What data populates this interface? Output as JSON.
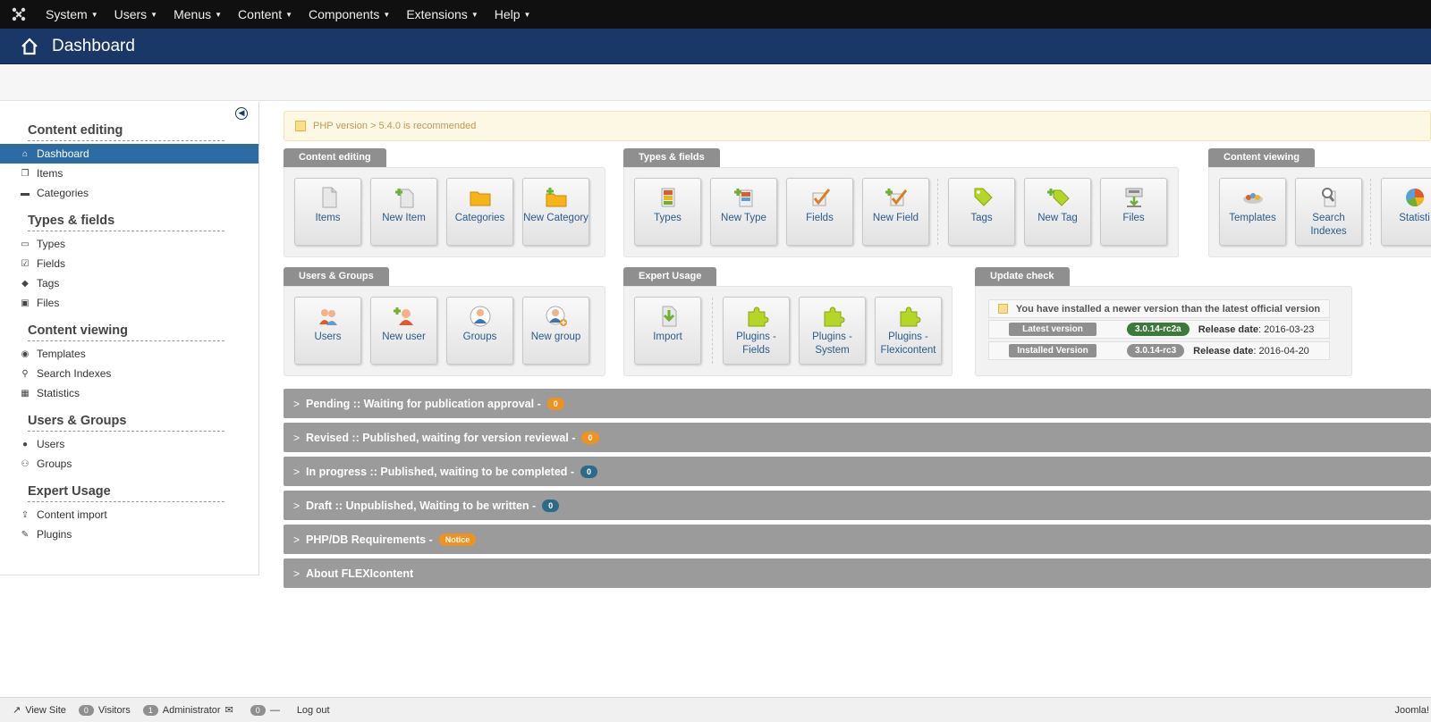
{
  "topnav": {
    "menu": [
      "System",
      "Users",
      "Menus",
      "Content",
      "Components",
      "Extensions",
      "Help"
    ]
  },
  "titlebar": {
    "title": "Dashboard"
  },
  "sidebar": {
    "sections": [
      {
        "title": "Content editing",
        "items": [
          {
            "label": "Dashboard",
            "icon": "home-icon",
            "active": true
          },
          {
            "label": "Items",
            "icon": "copy-icon"
          },
          {
            "label": "Categories",
            "icon": "folder-icon"
          }
        ]
      },
      {
        "title": "Types & fields",
        "items": [
          {
            "label": "Types",
            "icon": "briefcase-icon"
          },
          {
            "label": "Fields",
            "icon": "checkbox-icon"
          },
          {
            "label": "Tags",
            "icon": "tag-icon"
          },
          {
            "label": "Files",
            "icon": "image-icon"
          }
        ]
      },
      {
        "title": "Content viewing",
        "items": [
          {
            "label": "Templates",
            "icon": "eye-icon"
          },
          {
            "label": "Search Indexes",
            "icon": "search-icon"
          },
          {
            "label": "Statistics",
            "icon": "chart-icon"
          }
        ]
      },
      {
        "title": "Users & Groups",
        "items": [
          {
            "label": "Users",
            "icon": "user-icon"
          },
          {
            "label": "Groups",
            "icon": "users-icon"
          }
        ]
      },
      {
        "title": "Expert Usage",
        "items": [
          {
            "label": "Content import",
            "icon": "upload-icon"
          },
          {
            "label": "Plugins",
            "icon": "plug-icon"
          }
        ]
      }
    ]
  },
  "alert": {
    "text": "PHP version > 5.4.0 is recommended"
  },
  "panels": {
    "content_editing": {
      "label": "Content editing",
      "tiles": [
        "Items",
        "New Item",
        "Categories",
        "New Category"
      ]
    },
    "types_fields": {
      "label": "Types & fields",
      "tiles": [
        "Types",
        "New Type",
        "Fields",
        "New Field",
        "Tags",
        "New Tag",
        "Files"
      ]
    },
    "content_viewing": {
      "label": "Content viewing",
      "tiles": [
        "Templates",
        "Search Indexes",
        "Statisti"
      ]
    },
    "users_groups": {
      "label": "Users & Groups",
      "tiles": [
        "Users",
        "New user",
        "Groups",
        "New group"
      ]
    },
    "expert_usage": {
      "label": "Expert Usage",
      "tiles": [
        "Import",
        "Plugins - Fields",
        "Plugins - System",
        "Plugins - Flexicontent"
      ]
    },
    "update_check": {
      "label": "Update check",
      "message": "You have installed a newer version than the latest official version",
      "latest_label": "Latest version",
      "latest_version": "3.0.14-rc2a",
      "latest_release_label": "Release date",
      "latest_release_date": ": 2016-03-23",
      "installed_label": "Installed Version",
      "installed_version": "3.0.14-rc3",
      "installed_release_label": "Release date",
      "installed_release_date": ": 2016-04-20",
      "latest_color": "#3c7a3c",
      "installed_color": "#8f8f8f"
    }
  },
  "accordions": [
    {
      "label": "Pending :: Waiting for publication approval -",
      "badge": "0",
      "badge_color": "#f0921e"
    },
    {
      "label": "Revised :: Published, waiting for version reviewal -",
      "badge": "0",
      "badge_color": "#f0921e"
    },
    {
      "label": "In progress :: Published, waiting to be completed -",
      "badge": "0",
      "badge_color": "#2d6a8a"
    },
    {
      "label": "Draft :: Unpublished, Waiting to be written -",
      "badge": "0",
      "badge_color": "#2d6a8a"
    },
    {
      "label": "PHP/DB Requirements -",
      "badge": "Notice",
      "badge_color": "#f0921e"
    },
    {
      "label": "About FLEXIcontent",
      "badge": "",
      "badge_color": ""
    }
  ],
  "footer": {
    "view_site": "View Site",
    "visitors_count": "0",
    "visitors_label": "Visitors",
    "admin_count": "1",
    "admin_label": "Administrator",
    "messages_count": "0",
    "logout": "Log out",
    "brand": "Joomla!"
  }
}
